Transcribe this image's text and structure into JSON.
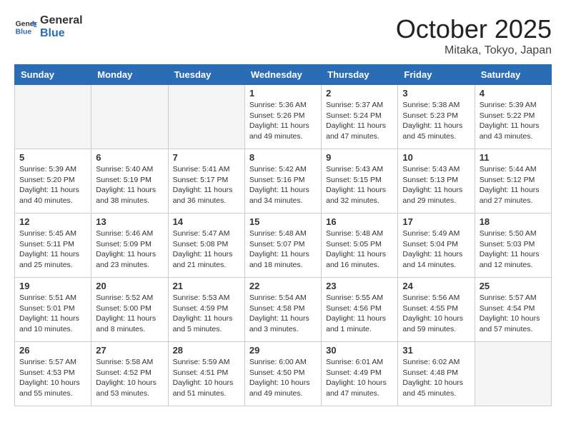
{
  "header": {
    "logo_line1": "General",
    "logo_line2": "Blue",
    "month": "October 2025",
    "location": "Mitaka, Tokyo, Japan"
  },
  "days_of_week": [
    "Sunday",
    "Monday",
    "Tuesday",
    "Wednesday",
    "Thursday",
    "Friday",
    "Saturday"
  ],
  "weeks": [
    [
      {
        "day": "",
        "info": ""
      },
      {
        "day": "",
        "info": ""
      },
      {
        "day": "",
        "info": ""
      },
      {
        "day": "1",
        "info": "Sunrise: 5:36 AM\nSunset: 5:26 PM\nDaylight: 11 hours\nand 49 minutes."
      },
      {
        "day": "2",
        "info": "Sunrise: 5:37 AM\nSunset: 5:24 PM\nDaylight: 11 hours\nand 47 minutes."
      },
      {
        "day": "3",
        "info": "Sunrise: 5:38 AM\nSunset: 5:23 PM\nDaylight: 11 hours\nand 45 minutes."
      },
      {
        "day": "4",
        "info": "Sunrise: 5:39 AM\nSunset: 5:22 PM\nDaylight: 11 hours\nand 43 minutes."
      }
    ],
    [
      {
        "day": "5",
        "info": "Sunrise: 5:39 AM\nSunset: 5:20 PM\nDaylight: 11 hours\nand 40 minutes."
      },
      {
        "day": "6",
        "info": "Sunrise: 5:40 AM\nSunset: 5:19 PM\nDaylight: 11 hours\nand 38 minutes."
      },
      {
        "day": "7",
        "info": "Sunrise: 5:41 AM\nSunset: 5:17 PM\nDaylight: 11 hours\nand 36 minutes."
      },
      {
        "day": "8",
        "info": "Sunrise: 5:42 AM\nSunset: 5:16 PM\nDaylight: 11 hours\nand 34 minutes."
      },
      {
        "day": "9",
        "info": "Sunrise: 5:43 AM\nSunset: 5:15 PM\nDaylight: 11 hours\nand 32 minutes."
      },
      {
        "day": "10",
        "info": "Sunrise: 5:43 AM\nSunset: 5:13 PM\nDaylight: 11 hours\nand 29 minutes."
      },
      {
        "day": "11",
        "info": "Sunrise: 5:44 AM\nSunset: 5:12 PM\nDaylight: 11 hours\nand 27 minutes."
      }
    ],
    [
      {
        "day": "12",
        "info": "Sunrise: 5:45 AM\nSunset: 5:11 PM\nDaylight: 11 hours\nand 25 minutes."
      },
      {
        "day": "13",
        "info": "Sunrise: 5:46 AM\nSunset: 5:09 PM\nDaylight: 11 hours\nand 23 minutes."
      },
      {
        "day": "14",
        "info": "Sunrise: 5:47 AM\nSunset: 5:08 PM\nDaylight: 11 hours\nand 21 minutes."
      },
      {
        "day": "15",
        "info": "Sunrise: 5:48 AM\nSunset: 5:07 PM\nDaylight: 11 hours\nand 18 minutes."
      },
      {
        "day": "16",
        "info": "Sunrise: 5:48 AM\nSunset: 5:05 PM\nDaylight: 11 hours\nand 16 minutes."
      },
      {
        "day": "17",
        "info": "Sunrise: 5:49 AM\nSunset: 5:04 PM\nDaylight: 11 hours\nand 14 minutes."
      },
      {
        "day": "18",
        "info": "Sunrise: 5:50 AM\nSunset: 5:03 PM\nDaylight: 11 hours\nand 12 minutes."
      }
    ],
    [
      {
        "day": "19",
        "info": "Sunrise: 5:51 AM\nSunset: 5:01 PM\nDaylight: 11 hours\nand 10 minutes."
      },
      {
        "day": "20",
        "info": "Sunrise: 5:52 AM\nSunset: 5:00 PM\nDaylight: 11 hours\nand 8 minutes."
      },
      {
        "day": "21",
        "info": "Sunrise: 5:53 AM\nSunset: 4:59 PM\nDaylight: 11 hours\nand 5 minutes."
      },
      {
        "day": "22",
        "info": "Sunrise: 5:54 AM\nSunset: 4:58 PM\nDaylight: 11 hours\nand 3 minutes."
      },
      {
        "day": "23",
        "info": "Sunrise: 5:55 AM\nSunset: 4:56 PM\nDaylight: 11 hours\nand 1 minute."
      },
      {
        "day": "24",
        "info": "Sunrise: 5:56 AM\nSunset: 4:55 PM\nDaylight: 10 hours\nand 59 minutes."
      },
      {
        "day": "25",
        "info": "Sunrise: 5:57 AM\nSunset: 4:54 PM\nDaylight: 10 hours\nand 57 minutes."
      }
    ],
    [
      {
        "day": "26",
        "info": "Sunrise: 5:57 AM\nSunset: 4:53 PM\nDaylight: 10 hours\nand 55 minutes."
      },
      {
        "day": "27",
        "info": "Sunrise: 5:58 AM\nSunset: 4:52 PM\nDaylight: 10 hours\nand 53 minutes."
      },
      {
        "day": "28",
        "info": "Sunrise: 5:59 AM\nSunset: 4:51 PM\nDaylight: 10 hours\nand 51 minutes."
      },
      {
        "day": "29",
        "info": "Sunrise: 6:00 AM\nSunset: 4:50 PM\nDaylight: 10 hours\nand 49 minutes."
      },
      {
        "day": "30",
        "info": "Sunrise: 6:01 AM\nSunset: 4:49 PM\nDaylight: 10 hours\nand 47 minutes."
      },
      {
        "day": "31",
        "info": "Sunrise: 6:02 AM\nSunset: 4:48 PM\nDaylight: 10 hours\nand 45 minutes."
      },
      {
        "day": "",
        "info": ""
      }
    ]
  ]
}
